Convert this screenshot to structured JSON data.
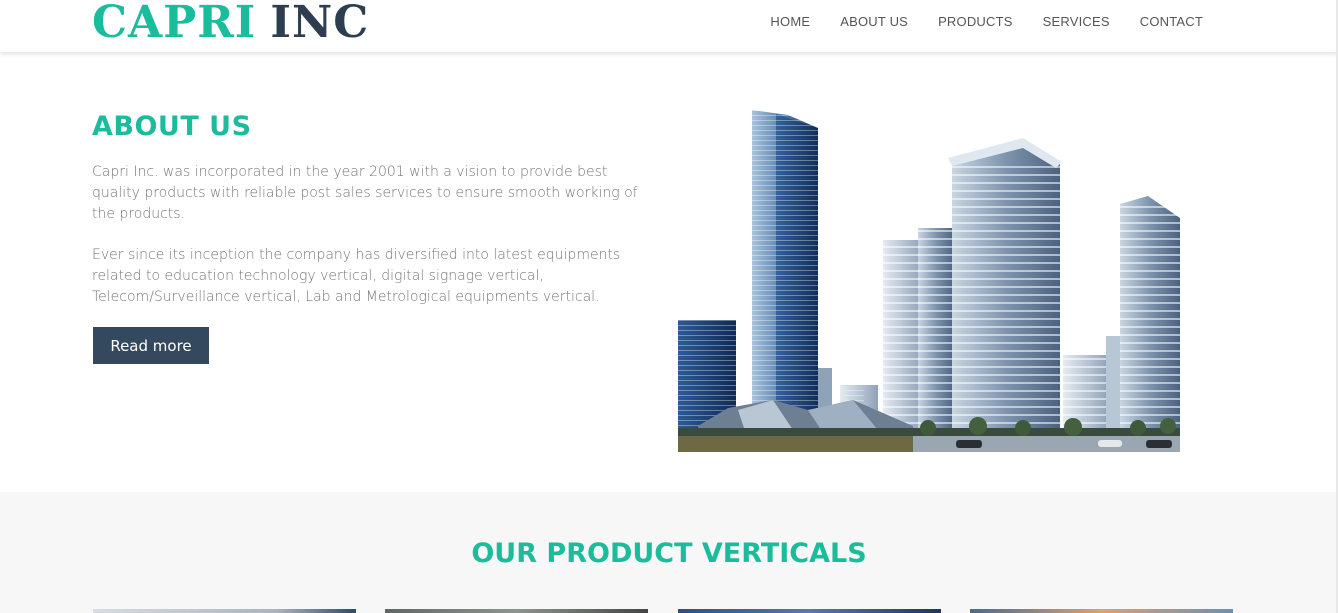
{
  "brand": {
    "word1": "CAPRI",
    "word2": "INC"
  },
  "nav": [
    "HOME",
    "ABOUT US",
    "PRODUCTS",
    "SERVICES",
    "CONTACT"
  ],
  "about": {
    "title": "ABOUT US",
    "paragraph1": "Capri Inc. was incorporated in the year 2001 with a vision to provide best quality products with reliable post sales services to ensure smooth working of the products.",
    "paragraph2": "Ever since its inception the company has diversified into latest equipments related to education technology vertical, digital signage vertical, Telecom/Surveillance vertical, Lab and Metrological equipments vertical.",
    "button": "Read more",
    "image": "city-skyline-image"
  },
  "products": {
    "title": "OUR PRODUCT VERTICALS"
  },
  "colors": {
    "accent": "#1abc9c",
    "dark": "#2c3e50",
    "button": "#34495e",
    "section_bg": "#f7f7f7"
  }
}
